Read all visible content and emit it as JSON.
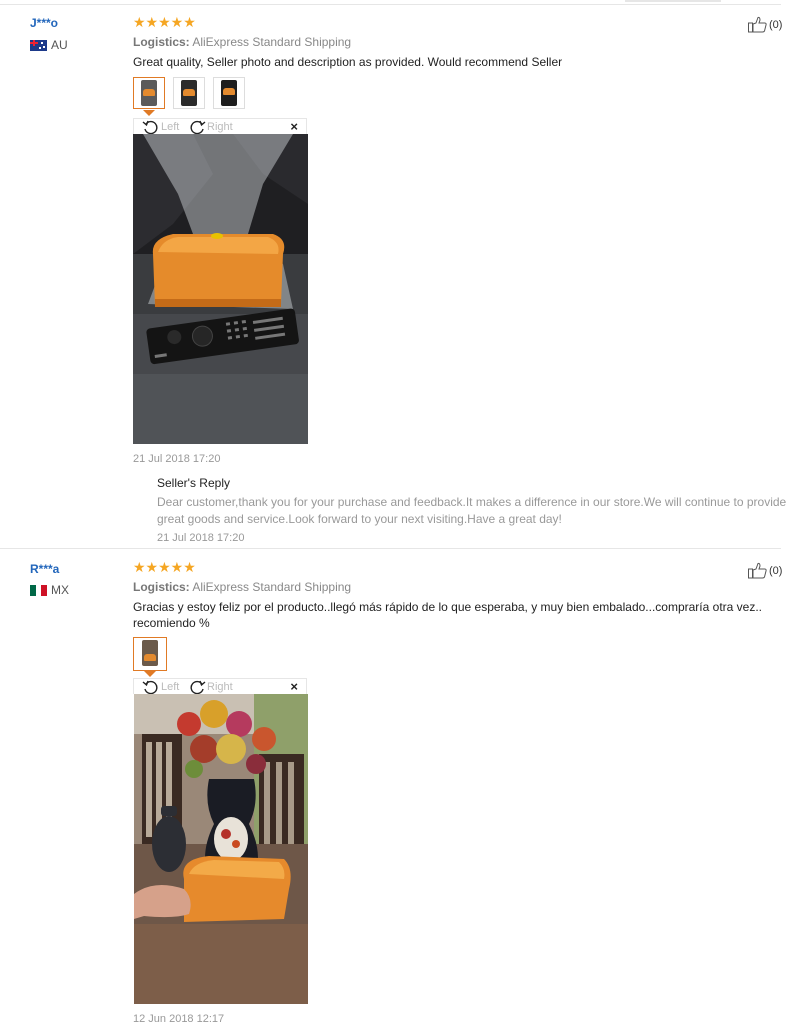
{
  "reviews": [
    {
      "user": "J***o",
      "country": "AU",
      "rating": "★★★★★",
      "logistics_label": "Logistics:",
      "logistics_value": "AliExpress Standard Shipping",
      "feedback": "Great quality, Seller photo and description as provided. Would recommend Seller",
      "helpful_count": "(0)",
      "rotate_left": "Left",
      "rotate_right": "Right",
      "close": "×",
      "date": "21 Jul 2018 17:20",
      "seller_reply": {
        "title": "Seller's Reply",
        "text": "Dear customer,thank you for your purchase and feedback.It makes a difference in our store.We will continue to provide great goods and service.Look forward to your next visiting.Have a great day!",
        "date": "21 Jul 2018 17:20"
      }
    },
    {
      "user": "R***a",
      "country": "MX",
      "rating": "★★★★★",
      "logistics_label": "Logistics:",
      "logistics_value": "AliExpress Standard Shipping",
      "feedback": "Gracias y estoy feliz por el producto..llegó más rápido de lo que esperaba, y muy bien embalado...compraría otra vez.. recomiendo %",
      "helpful_count": "(0)",
      "rotate_left": "Left",
      "rotate_right": "Right",
      "close": "×",
      "date": "12 Jun 2018 12:17"
    }
  ],
  "colors": {
    "accent": "#e07a25",
    "star": "#f5a623",
    "username": "#2266bb"
  }
}
